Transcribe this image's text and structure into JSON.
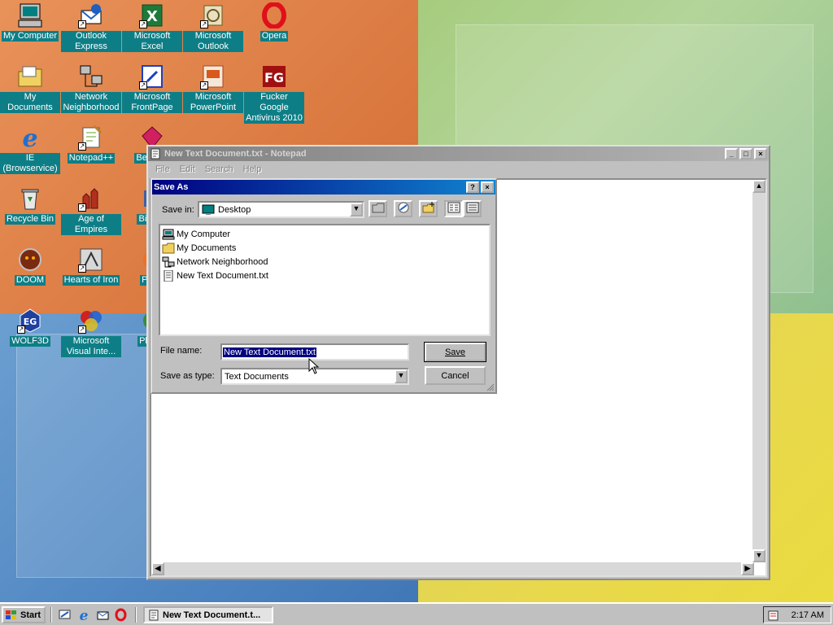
{
  "desktop_icons": [
    {
      "label": "My Computer",
      "icon": "my-computer-icon"
    },
    {
      "label": "Outlook Express",
      "icon": "outlook-express-icon"
    },
    {
      "label": "Microsoft Excel",
      "icon": "excel-icon"
    },
    {
      "label": "Microsoft Outlook",
      "icon": "outlook-icon"
    },
    {
      "label": "Opera",
      "icon": "opera-icon"
    },
    {
      "label": "My Documents",
      "icon": "my-documents-icon"
    },
    {
      "label": "Network Neighborhood",
      "icon": "network-icon"
    },
    {
      "label": "Microsoft FrontPage",
      "icon": "frontpage-icon"
    },
    {
      "label": "Microsoft PowerPoint",
      "icon": "powerpoint-icon"
    },
    {
      "label": "Fucker Google Antivirus 2010",
      "icon": "antivirus-icon"
    },
    {
      "label": "IE (Browservice)",
      "icon": "ie-icon"
    },
    {
      "label": "Notepad++",
      "icon": "notepadpp-icon"
    },
    {
      "label": "Beje De",
      "icon": "bejeweled-icon"
    },
    {
      "label": "Recycle Bin",
      "icon": "recycle-bin-icon"
    },
    {
      "label": "Age of Empires",
      "icon": "age-of-empires-icon"
    },
    {
      "label": "Big De",
      "icon": "big-icon"
    },
    {
      "label": "DOOM",
      "icon": "doom-icon"
    },
    {
      "label": "Hearts of Iron",
      "icon": "hearts-of-iron-icon"
    },
    {
      "label": "Pegg",
      "icon": "peggle-icon"
    },
    {
      "label": "WOLF3D",
      "icon": "wolf3d-icon"
    },
    {
      "label": "Microsoft Visual Inte...",
      "icon": "visual-interdev-icon"
    },
    {
      "label": "Pla Zo",
      "icon": "planet-zoo-icon"
    }
  ],
  "notepad": {
    "title": "New Text Document.txt - Notepad",
    "menu": [
      "File",
      "Edit",
      "Search",
      "Help"
    ]
  },
  "save_dialog": {
    "title": "Save As",
    "help_glyph": "?",
    "close_glyph": "×",
    "save_in_label": "Save in:",
    "save_in_value": "Desktop",
    "files": [
      {
        "name": "My Computer",
        "icon": "my-computer-icon"
      },
      {
        "name": "My Documents",
        "icon": "folder-icon"
      },
      {
        "name": "Network Neighborhood",
        "icon": "network-icon"
      },
      {
        "name": "New Text Document.txt",
        "icon": "text-file-icon"
      }
    ],
    "file_name_label": "File name:",
    "file_name_value": "New Text Document.txt",
    "save_as_type_label": "Save as type:",
    "save_as_type_value": "Text Documents",
    "save_button": "Save",
    "cancel_button": "Cancel"
  },
  "taskbar": {
    "start_label": "Start",
    "task_button": "New Text Document.t...",
    "clock": "2:17 AM"
  },
  "colors": {
    "title_active": "#000080",
    "title_inactive": "#808080",
    "icon_label_bg": "#0e7e86",
    "face": "#c0c0c0"
  }
}
